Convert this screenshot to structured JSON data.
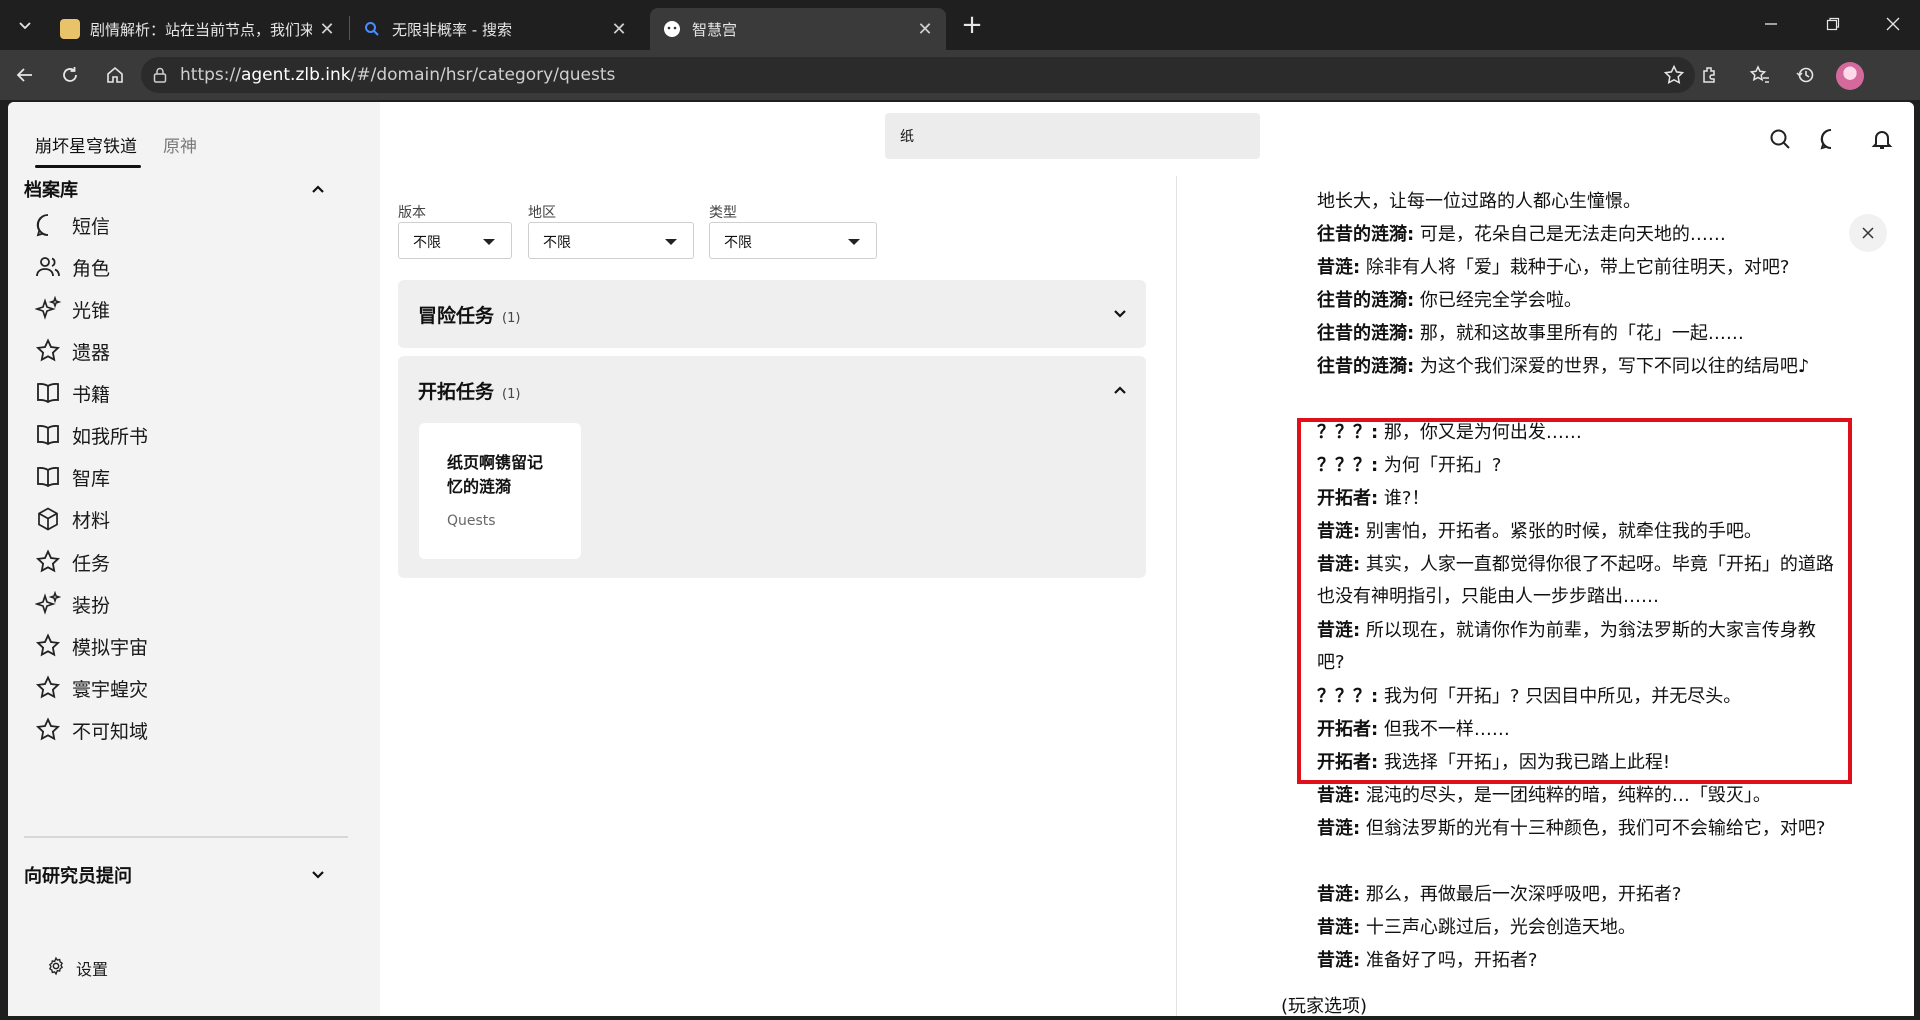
{
  "browser": {
    "tabs": [
      {
        "title": "剧情解析：站在当前节点，我们来",
        "close": "✕"
      },
      {
        "title": "无限非概率 - 搜索",
        "close": "✕"
      },
      {
        "title": "智慧宫",
        "close": "✕"
      }
    ],
    "new_tab": "+",
    "url_prefix": "https://",
    "url_host": "agent.zlb.ink",
    "url_path": "/#/domain/hsr/category/quests"
  },
  "sidebar": {
    "game_tabs": [
      "崩坏星穹铁道",
      "原神"
    ],
    "archive_title": "档案库",
    "items": [
      {
        "label": "短信",
        "icon": "chat-bubble-icon"
      },
      {
        "label": "角色",
        "icon": "users-icon"
      },
      {
        "label": "光锥",
        "icon": "sparkles-icon"
      },
      {
        "label": "遗器",
        "icon": "star-icon"
      },
      {
        "label": "书籍",
        "icon": "book-icon"
      },
      {
        "label": "如我所书",
        "icon": "book-icon"
      },
      {
        "label": "智库",
        "icon": "book-icon"
      },
      {
        "label": "材料",
        "icon": "cube-icon"
      },
      {
        "label": "任务",
        "icon": "star-icon"
      },
      {
        "label": "装扮",
        "icon": "sparkles-icon"
      },
      {
        "label": "模拟宇宙",
        "icon": "star-icon"
      },
      {
        "label": "寰宇蝗灾",
        "icon": "star-icon"
      },
      {
        "label": "不可知域",
        "icon": "star-icon"
      }
    ],
    "ask_title": "向研究员提问",
    "settings_label": "设置"
  },
  "header": {
    "search_value": "纸"
  },
  "filters": [
    {
      "label": "版本",
      "value": "不限"
    },
    {
      "label": "地区",
      "value": "不限"
    },
    {
      "label": "类型",
      "value": "不限"
    }
  ],
  "sections": [
    {
      "title": "冒险任务",
      "count": "(1)",
      "expanded": false
    },
    {
      "title": "开拓任务",
      "count": "(1)",
      "expanded": true,
      "cards": [
        {
          "title": "纸页啊镌留记忆的涟漪",
          "subtitle": "Quests"
        }
      ]
    }
  ],
  "dialogue": [
    {
      "speaker": "",
      "text": "地长大，让每一位过路的人都心生憧憬。"
    },
    {
      "speaker": "往昔的涟漪:",
      "text": " 可是，花朵自己是无法走向天地的……"
    },
    {
      "speaker": "昔涟:",
      "text": " 除非有人将「爱」栽种于心，带上它前往明天，对吧?"
    },
    {
      "speaker": "往昔的涟漪:",
      "text": " 你已经完全学会啦。"
    },
    {
      "speaker": "往昔的涟漪:",
      "text": " 那，就和这故事里所有的「花」一起……"
    },
    {
      "speaker": "往昔的涟漪:",
      "text": " 为这个我们深爱的世界，写下不同以往的结局吧♪"
    },
    {
      "speaker": "？？？:",
      "text": " 那，你又是为何出发……"
    },
    {
      "speaker": "？？？:",
      "text": " 为何「开拓」?"
    },
    {
      "speaker": "开拓者:",
      "text": " 谁?！"
    },
    {
      "speaker": "昔涟:",
      "text": " 别害怕，开拓者。紧张的时候，就牵住我的手吧。"
    },
    {
      "speaker": "昔涟:",
      "text": " 其实，人家一直都觉得你很了不起呀。毕竟「开拓」的道路也没有神明指引，只能由人一步步踏出……"
    },
    {
      "speaker": "昔涟:",
      "text": " 所以现在，就请你作为前辈，为翁法罗斯的大家言传身教吧?"
    },
    {
      "speaker": "？？？:",
      "text": " 我为何「开拓」? 只因目中所见，并无尽头。"
    },
    {
      "speaker": "开拓者:",
      "text": " 但我不一样……"
    },
    {
      "speaker": "开拓者:",
      "text": " 我选择「开拓」，因为我已踏上此程!"
    },
    {
      "speaker": "昔涟:",
      "text": " 混沌的尽头，是一团纯粹的暗，纯粹的…「毁灭」。"
    },
    {
      "speaker": "昔涟:",
      "text": " 但翁法罗斯的光有十三种颜色，我们可不会输给它，对吧?"
    },
    {
      "speaker": "昔涟:",
      "text": " 那么，再做最后一次深呼吸吧，开拓者?"
    },
    {
      "speaker": "昔涟:",
      "text": " 十三声心跳过后，光会创造天地。"
    },
    {
      "speaker": "昔涟:",
      "text": " 准备好了吗，开拓者?"
    }
  ],
  "dialogue_cut": "(玩家选项)",
  "colors": {
    "highlight": "#e0101a",
    "accent": "#111111"
  }
}
